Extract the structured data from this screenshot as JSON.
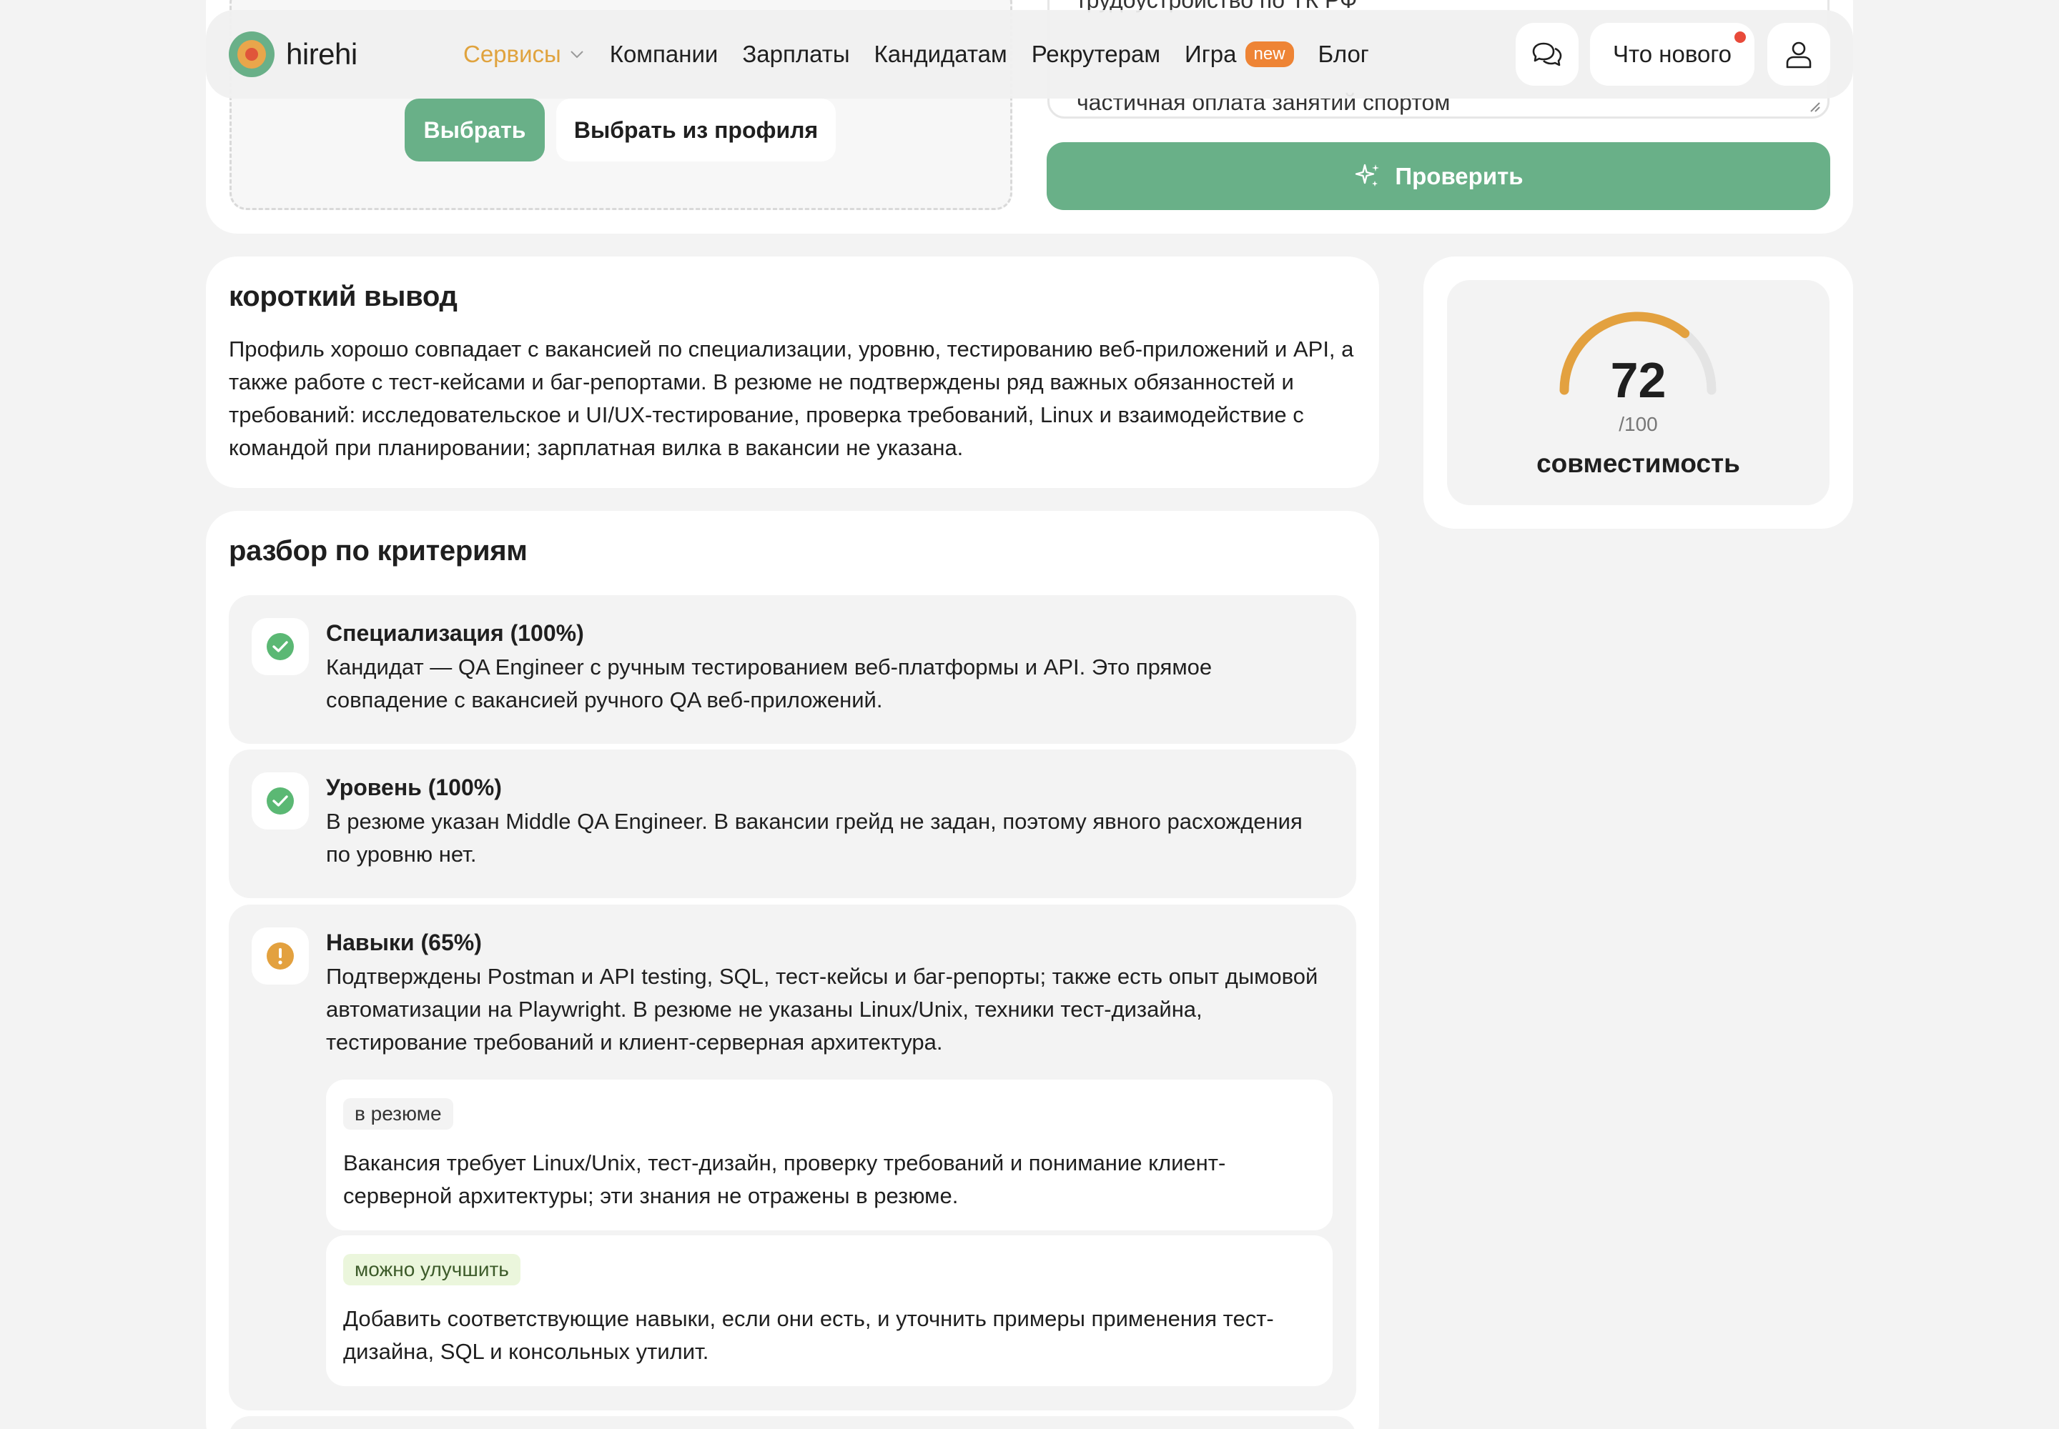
{
  "top_section": {
    "choose_button": "Выбрать",
    "choose_from_profile_button": "Выбрать из профиля",
    "textarea_top_cut": "трудоустройство по ТК РФ",
    "textarea_visible_line": "частичная оплата занятий спортом",
    "check_button": "Проверить"
  },
  "header": {
    "logo_text": "hirehi",
    "nav": {
      "services": "Сервисы",
      "companies": "Компании",
      "salaries": "Зарплаты",
      "candidates": "Кандидатам",
      "recruiters": "Рекрутерам",
      "game": "Игра",
      "game_badge": "new",
      "blog": "Блог"
    },
    "whats_new": "Что нового"
  },
  "summary": {
    "title": "короткий вывод",
    "text": "Профиль хорошо совпадает с вакансией по специализации, уровню, тестированию веб-приложений и API, а также работе с тест-кейсами и баг-репортами. В резюме не подтверждены ряд важных обязанностей и требований: исследовательское и UI/UX-тестирование, проверка требований, Linux и взаимодействие с командой при планировании; зарплатная вилка в вакансии не указана."
  },
  "score": {
    "value": "72",
    "max": "/100",
    "fraction": 0.72,
    "label": "совместимость",
    "arc_color": "#e3a13f",
    "track_color": "#e4e4e4"
  },
  "criteria": {
    "title": "разбор по критериям",
    "items": [
      {
        "title": "Специализация (100%)",
        "text": "Кандидат — QA Engineer с ручным тестированием веб-платформы и API. Это прямое совпадение с вакансией ручного QA веб-приложений.",
        "status_icon": "check-circle-icon",
        "status_color": "#5bb874"
      },
      {
        "title": "Уровень (100%)",
        "text": "В резюме указан Middle QA Engineer. В вакансии грейд не задан, поэтому явного расхождения по уровню нет.",
        "status_icon": "check-circle-icon",
        "status_color": "#5bb874"
      },
      {
        "title": "Навыки (65%)",
        "text": "Подтверждены Postman и API testing, SQL, тест-кейсы и баг-репорты; также есть опыт дымовой автоматизации на Playwright. В резюме не указаны Linux/Unix, техники тест-дизайна, тестирование требований и клиент-серверная архитектура.",
        "status_icon": "warning-circle-icon",
        "status_color": "#e3a13f",
        "notes": [
          {
            "tag": "в резюме",
            "text": "Вакансия требует Linux/Unix, тест-дизайн, проверку требований и понимание клиент-серверной архитектуры; эти знания не отражены в резюме."
          },
          {
            "tag": "можно улучшить",
            "text": "Добавить соответствующие навыки, если они есть, и уточнить примеры применения тест-дизайна, SQL и консольных утилит."
          }
        ]
      }
    ]
  }
}
